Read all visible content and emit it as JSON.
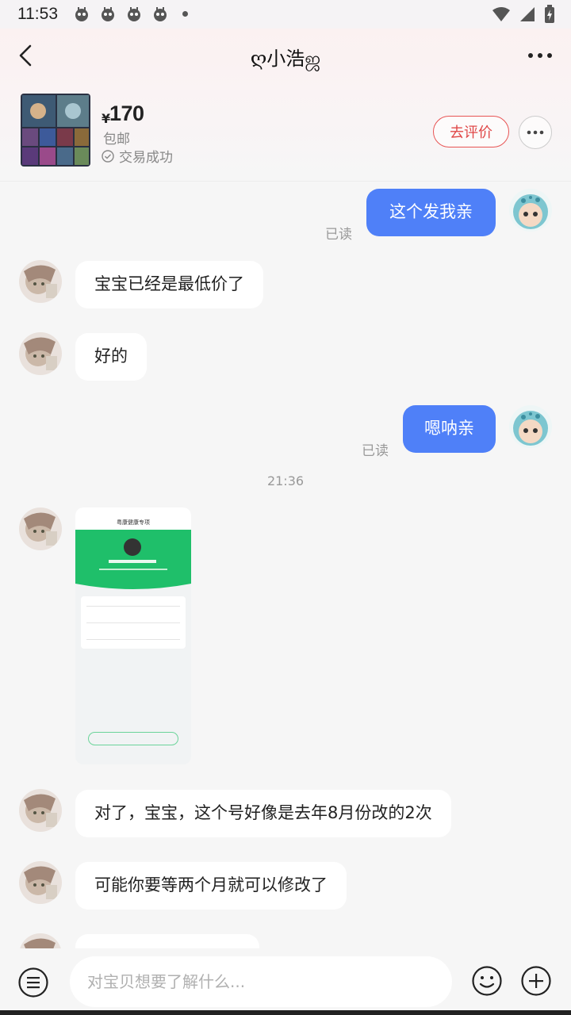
{
  "status_bar": {
    "time": "11:53"
  },
  "header": {
    "title": "ღ小浩ஜ",
    "product": {
      "currency": "¥",
      "price": "170",
      "shipping": "包邮",
      "deal_status": "交易成功"
    },
    "review_button": "去评价"
  },
  "messages": [
    {
      "side": "out",
      "text": "这个发我亲",
      "read": "已读"
    },
    {
      "side": "in",
      "text": "宝宝已经是最低价了"
    },
    {
      "side": "in",
      "text": "好的"
    },
    {
      "side": "out",
      "text": "嗯呐亲",
      "read": "已读"
    },
    {
      "type": "time",
      "text": "21:36"
    },
    {
      "side": "in",
      "type": "image",
      "image_title": "粤康健康专项"
    },
    {
      "side": "in",
      "text": "对了，宝宝，这个号好像是去年8月份改的2次"
    },
    {
      "side": "in",
      "text": "可能你要等两个月就可以修改了"
    }
  ],
  "input": {
    "placeholder": "对宝贝想要了解什么..."
  },
  "colors": {
    "accent_blue": "#4f80f8",
    "review_red": "#e04848",
    "background": "#f6f6f6"
  }
}
